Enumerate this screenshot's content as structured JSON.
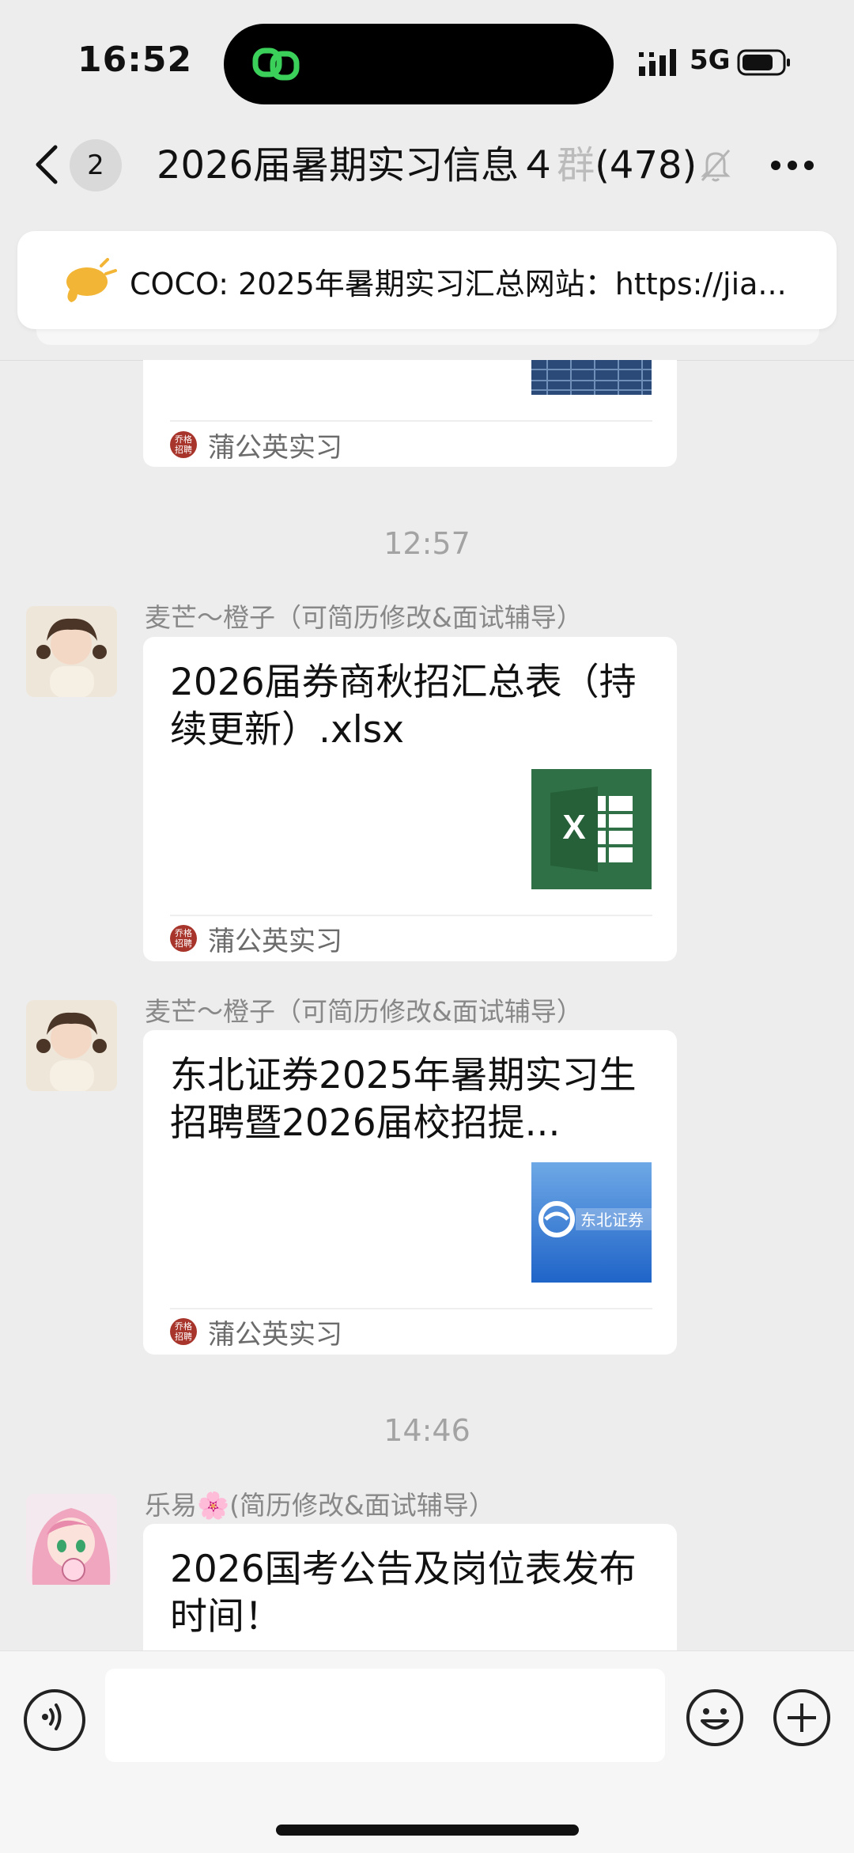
{
  "status": {
    "time": "16:52",
    "network": "5G"
  },
  "nav": {
    "unread_badge": "2",
    "title_main": "2026届暑期实习信息４",
    "title_faded": "群",
    "title_count": "(478)"
  },
  "notice": {
    "text": "COCO: 2025年暑期实习汇总网站：https://jia..."
  },
  "messages": [
    {
      "source": "蒲公英实习",
      "logo_text": "乔格\n招聘"
    },
    {
      "time": "12:57",
      "sender": "麦芒～橙子（可简历修改&面试辅导）",
      "title": "2026届券商秋招汇总表（持续更新）.xlsx",
      "source": "蒲公英实习",
      "logo_text": "乔格\n招聘"
    },
    {
      "sender": "麦芒～橙子（可简历修改&面试辅导）",
      "title": "东北证券2025年暑期实习生招聘暨2026届校招提...",
      "thumb_text": "东北证券",
      "source": "蒲公英实习",
      "logo_text": "乔格\n招聘"
    },
    {
      "time": "14:46",
      "sender": "乐易🌸(简历修改&面试辅导）",
      "title": "2026国考公告及岗位表发布时间！"
    }
  ],
  "colors": {
    "background": "#ededed",
    "excel_green": "#2f7046",
    "source_logo": "#a8352b"
  },
  "icons": [
    "back-icon",
    "mute-icon",
    "more-icon",
    "megaphone-icon",
    "voice-icon",
    "emoji-icon",
    "plus-icon"
  ]
}
